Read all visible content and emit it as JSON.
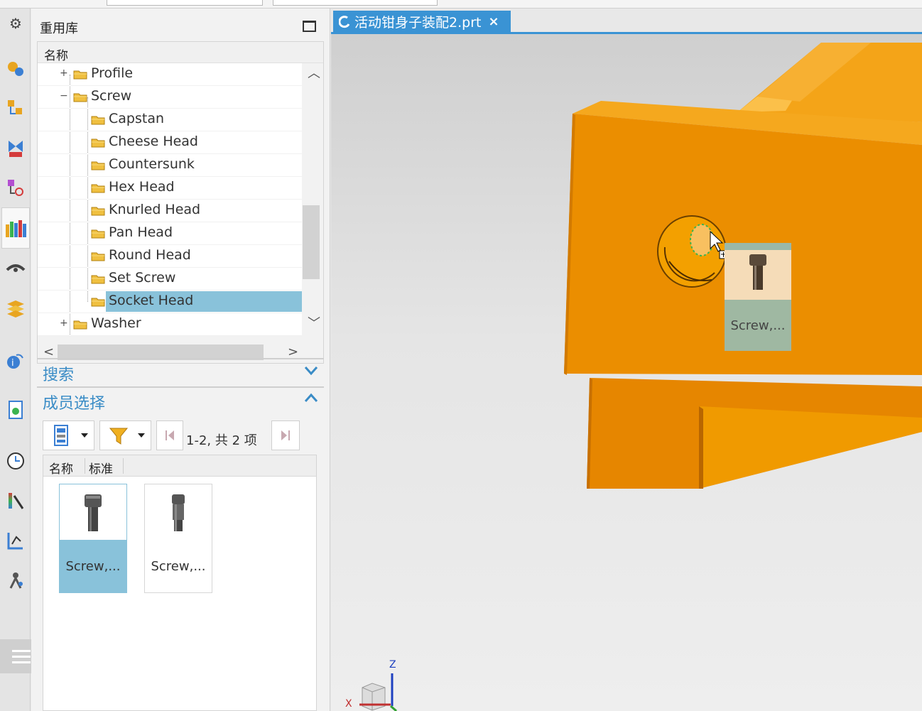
{
  "panel": {
    "title": "重用库",
    "tree": {
      "column_header": "名称",
      "nodes": [
        {
          "label": "Profile",
          "level": 1,
          "expander": "+"
        },
        {
          "label": "Screw",
          "level": 1,
          "expander": "−"
        },
        {
          "label": "Capstan",
          "level": 2,
          "expander": ""
        },
        {
          "label": "Cheese Head",
          "level": 2,
          "expander": ""
        },
        {
          "label": "Countersunk",
          "level": 2,
          "expander": ""
        },
        {
          "label": "Hex Head",
          "level": 2,
          "expander": ""
        },
        {
          "label": "Knurled Head",
          "level": 2,
          "expander": ""
        },
        {
          "label": "Pan Head",
          "level": 2,
          "expander": ""
        },
        {
          "label": "Round Head",
          "level": 2,
          "expander": ""
        },
        {
          "label": "Set Screw",
          "level": 2,
          "expander": ""
        },
        {
          "label": "Socket Head",
          "level": 2,
          "expander": "",
          "selected": true
        },
        {
          "label": "Washer",
          "level": 1,
          "expander": "+"
        }
      ]
    },
    "search": {
      "title": "搜索"
    },
    "members": {
      "title": "成员选择",
      "range_label": "1-2,  共 2 项",
      "columns": [
        "名称",
        "标准"
      ],
      "items": [
        {
          "label": "Screw,...",
          "selected": true
        },
        {
          "label": "Screw,...",
          "selected": false
        }
      ]
    }
  },
  "graphics": {
    "tab_title": "活动钳身子装配2.prt",
    "tab_close": "×",
    "drag_preview_label": "Screw,...",
    "triad": {
      "z": "Z",
      "x": "X"
    }
  },
  "colors": {
    "accent": "#3a93d4",
    "selection": "#89c2da",
    "model_orange": "#f09a00",
    "section_title": "#3a8cc6"
  },
  "icons": {
    "rail": [
      "gear-icon",
      "assembly-constraints-icon",
      "assembly-navigator-icon",
      "constraint-navigator-icon",
      "part-navigator-icon",
      "reuse-library-icon",
      "visual-icon",
      "layers-icon",
      "info-icon",
      "web-browser-icon",
      "history-icon",
      "analysis-icon",
      "process-icon",
      "roles-icon",
      "more-icon"
    ]
  }
}
